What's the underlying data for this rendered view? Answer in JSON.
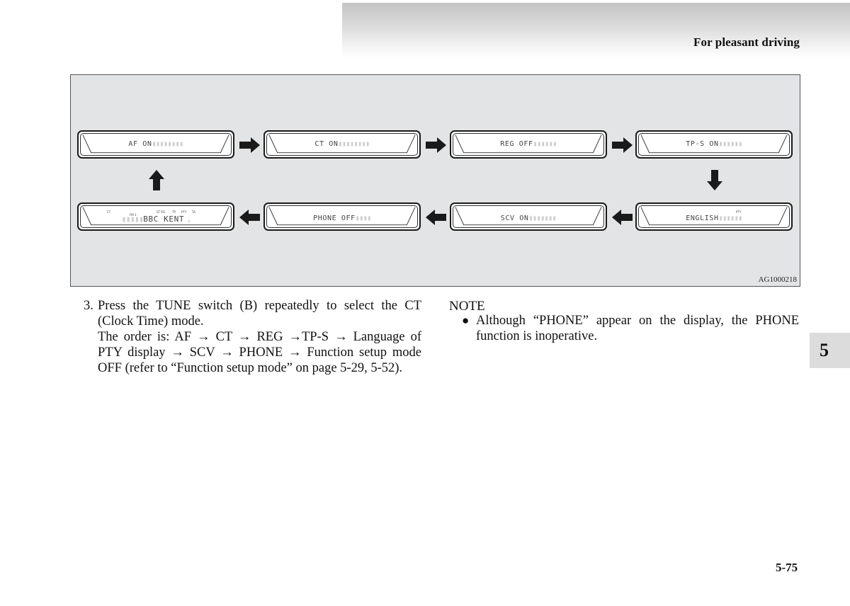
{
  "header": {
    "section_title": "For pleasant driving"
  },
  "figure": {
    "id": "AG1000218",
    "displays": [
      {
        "text": "AF ON",
        "trail": "▮▮▮▮▮▮▮▮"
      },
      {
        "text": "CT ON",
        "trail": "▮▮▮▮▮▮▮▮"
      },
      {
        "text": "REG OFF",
        "trail": "▮▮▮▮▮▮"
      },
      {
        "text": "TP-S ON",
        "trail": "▮▮▮▮▮▮"
      },
      {
        "text": "ENGLISH",
        "trail": "▮▮▮▮▮▮"
      },
      {
        "text": "SCV ON",
        "trail": "▮▮▮▮▮▮▮"
      },
      {
        "text": "PHONE OFF",
        "trail": "▮▮▮▮"
      },
      {
        "lead": "▮▮▮▮▮",
        "text": "BBC KENT",
        "trail": ""
      }
    ],
    "bbc_indicators": {
      "ct": "CT",
      "band": "FM 1",
      "st": "ST RG",
      "tp": "TP",
      "pty": "PTY",
      "ta": "TA"
    },
    "english_indicator": "PTY"
  },
  "step": {
    "number": "3.",
    "line1": "Press the TUNE switch (B) repeatedly to select the CT (Clock Time) mode.",
    "line2": "The order is: AF → CT → REG →TP-S → Language of PTY display → SCV → PHONE → Function setup mode OFF (refer to “Function setup mode” on page 5-29, 5-52)."
  },
  "note": {
    "title": "NOTE",
    "bullet": "●",
    "text": "Although “PHONE” appear on the display, the PHONE function is inoperative."
  },
  "chapter_tab": "5",
  "page_number": "5-75"
}
